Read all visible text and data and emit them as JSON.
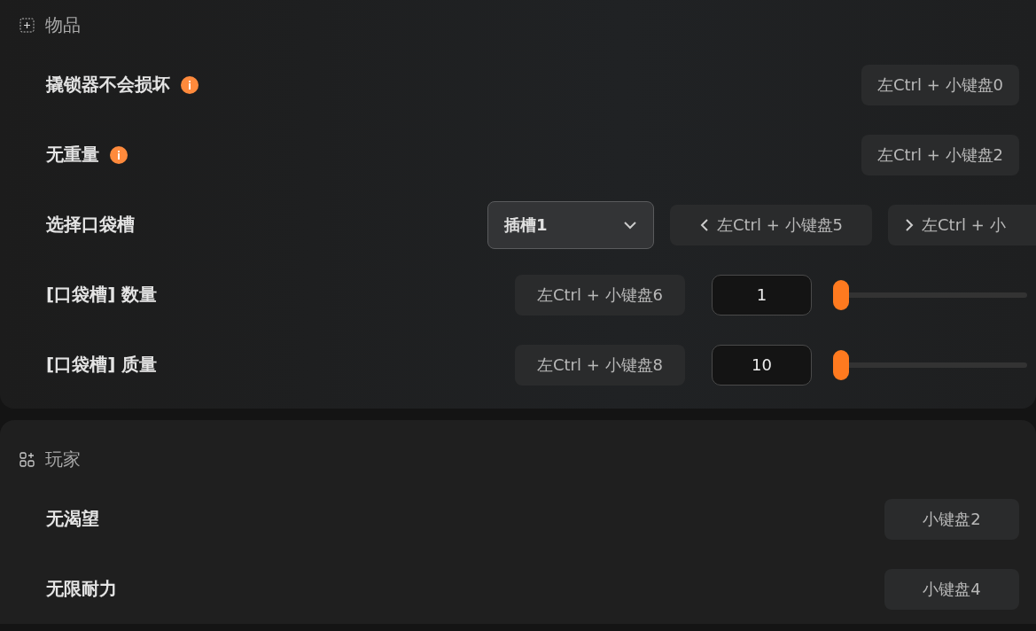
{
  "sections": [
    {
      "title": "物品",
      "rows": [
        {
          "kind": "hotkey",
          "label": "撬锁器不会损坏",
          "info": true,
          "hotkey": "左Ctrl + 小键盘0"
        },
        {
          "kind": "hotkey",
          "label": "无重量",
          "info": true,
          "hotkey": "左Ctrl + 小键盘2"
        },
        {
          "kind": "select",
          "label": "选择口袋槽",
          "value": "插槽1",
          "prev": "左Ctrl + 小键盘5",
          "next": "左Ctrl + 小"
        },
        {
          "kind": "slider",
          "label": "[口袋槽] 数量",
          "hotkey": "左Ctrl + 小键盘6",
          "value": "1",
          "level": 0
        },
        {
          "kind": "slider",
          "label": "[口袋槽] 质量",
          "hotkey": "左Ctrl + 小键盘8",
          "value": "10",
          "level": 0
        }
      ]
    },
    {
      "title": "玩家",
      "rows": [
        {
          "kind": "hotkey",
          "label": "无渴望",
          "info": false,
          "hotkey": "小键盘2"
        },
        {
          "kind": "hotkey",
          "label": "无限耐力",
          "info": false,
          "hotkey": "小键盘4"
        }
      ]
    }
  ]
}
